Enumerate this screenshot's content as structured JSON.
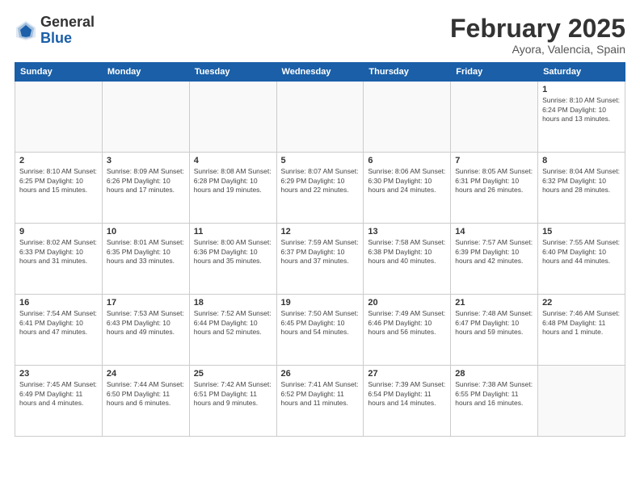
{
  "logo": {
    "general": "General",
    "blue": "Blue"
  },
  "title": "February 2025",
  "subtitle": "Ayora, Valencia, Spain",
  "days_header": [
    "Sunday",
    "Monday",
    "Tuesday",
    "Wednesday",
    "Thursday",
    "Friday",
    "Saturday"
  ],
  "weeks": [
    [
      {
        "day": "",
        "info": ""
      },
      {
        "day": "",
        "info": ""
      },
      {
        "day": "",
        "info": ""
      },
      {
        "day": "",
        "info": ""
      },
      {
        "day": "",
        "info": ""
      },
      {
        "day": "",
        "info": ""
      },
      {
        "day": "1",
        "info": "Sunrise: 8:10 AM\nSunset: 6:24 PM\nDaylight: 10 hours\nand 13 minutes."
      }
    ],
    [
      {
        "day": "2",
        "info": "Sunrise: 8:10 AM\nSunset: 6:25 PM\nDaylight: 10 hours\nand 15 minutes."
      },
      {
        "day": "3",
        "info": "Sunrise: 8:09 AM\nSunset: 6:26 PM\nDaylight: 10 hours\nand 17 minutes."
      },
      {
        "day": "4",
        "info": "Sunrise: 8:08 AM\nSunset: 6:28 PM\nDaylight: 10 hours\nand 19 minutes."
      },
      {
        "day": "5",
        "info": "Sunrise: 8:07 AM\nSunset: 6:29 PM\nDaylight: 10 hours\nand 22 minutes."
      },
      {
        "day": "6",
        "info": "Sunrise: 8:06 AM\nSunset: 6:30 PM\nDaylight: 10 hours\nand 24 minutes."
      },
      {
        "day": "7",
        "info": "Sunrise: 8:05 AM\nSunset: 6:31 PM\nDaylight: 10 hours\nand 26 minutes."
      },
      {
        "day": "8",
        "info": "Sunrise: 8:04 AM\nSunset: 6:32 PM\nDaylight: 10 hours\nand 28 minutes."
      }
    ],
    [
      {
        "day": "9",
        "info": "Sunrise: 8:02 AM\nSunset: 6:33 PM\nDaylight: 10 hours\nand 31 minutes."
      },
      {
        "day": "10",
        "info": "Sunrise: 8:01 AM\nSunset: 6:35 PM\nDaylight: 10 hours\nand 33 minutes."
      },
      {
        "day": "11",
        "info": "Sunrise: 8:00 AM\nSunset: 6:36 PM\nDaylight: 10 hours\nand 35 minutes."
      },
      {
        "day": "12",
        "info": "Sunrise: 7:59 AM\nSunset: 6:37 PM\nDaylight: 10 hours\nand 37 minutes."
      },
      {
        "day": "13",
        "info": "Sunrise: 7:58 AM\nSunset: 6:38 PM\nDaylight: 10 hours\nand 40 minutes."
      },
      {
        "day": "14",
        "info": "Sunrise: 7:57 AM\nSunset: 6:39 PM\nDaylight: 10 hours\nand 42 minutes."
      },
      {
        "day": "15",
        "info": "Sunrise: 7:55 AM\nSunset: 6:40 PM\nDaylight: 10 hours\nand 44 minutes."
      }
    ],
    [
      {
        "day": "16",
        "info": "Sunrise: 7:54 AM\nSunset: 6:41 PM\nDaylight: 10 hours\nand 47 minutes."
      },
      {
        "day": "17",
        "info": "Sunrise: 7:53 AM\nSunset: 6:43 PM\nDaylight: 10 hours\nand 49 minutes."
      },
      {
        "day": "18",
        "info": "Sunrise: 7:52 AM\nSunset: 6:44 PM\nDaylight: 10 hours\nand 52 minutes."
      },
      {
        "day": "19",
        "info": "Sunrise: 7:50 AM\nSunset: 6:45 PM\nDaylight: 10 hours\nand 54 minutes."
      },
      {
        "day": "20",
        "info": "Sunrise: 7:49 AM\nSunset: 6:46 PM\nDaylight: 10 hours\nand 56 minutes."
      },
      {
        "day": "21",
        "info": "Sunrise: 7:48 AM\nSunset: 6:47 PM\nDaylight: 10 hours\nand 59 minutes."
      },
      {
        "day": "22",
        "info": "Sunrise: 7:46 AM\nSunset: 6:48 PM\nDaylight: 11 hours\nand 1 minute."
      }
    ],
    [
      {
        "day": "23",
        "info": "Sunrise: 7:45 AM\nSunset: 6:49 PM\nDaylight: 11 hours\nand 4 minutes."
      },
      {
        "day": "24",
        "info": "Sunrise: 7:44 AM\nSunset: 6:50 PM\nDaylight: 11 hours\nand 6 minutes."
      },
      {
        "day": "25",
        "info": "Sunrise: 7:42 AM\nSunset: 6:51 PM\nDaylight: 11 hours\nand 9 minutes."
      },
      {
        "day": "26",
        "info": "Sunrise: 7:41 AM\nSunset: 6:52 PM\nDaylight: 11 hours\nand 11 minutes."
      },
      {
        "day": "27",
        "info": "Sunrise: 7:39 AM\nSunset: 6:54 PM\nDaylight: 11 hours\nand 14 minutes."
      },
      {
        "day": "28",
        "info": "Sunrise: 7:38 AM\nSunset: 6:55 PM\nDaylight: 11 hours\nand 16 minutes."
      },
      {
        "day": "",
        "info": ""
      }
    ]
  ]
}
